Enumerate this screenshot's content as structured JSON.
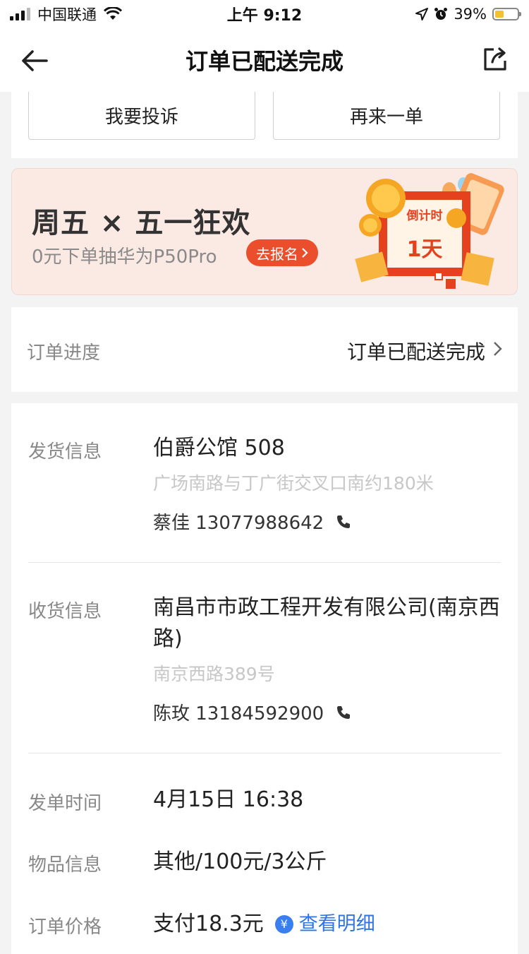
{
  "status_bar": {
    "carrier": "中国联通",
    "time": "上午 9:12",
    "battery_pct": "39%",
    "battery_level": 0.39,
    "icons": [
      "signal-icon",
      "wifi-icon",
      "location-arrow-icon",
      "alarm-icon",
      "battery-icon"
    ]
  },
  "nav": {
    "title": "订单已配送完成",
    "back_icon": "arrow-left-icon",
    "share_icon": "share-icon"
  },
  "actions": {
    "complain": "我要投诉",
    "reorder": "再来一单"
  },
  "banner": {
    "title": "周五 × 五一狂欢",
    "subtitle": "0元下单抽华为P50Pro",
    "cta": "去报名",
    "badge_line1": "倒计时",
    "badge_line2": "1天"
  },
  "progress": {
    "label": "订单进度",
    "status": "订单已配送完成"
  },
  "shipping": {
    "label": "发货信息",
    "name": "伯爵公馆 508",
    "address": "广场南路与丁广街交叉口南约180米",
    "contact": "蔡佳 13077988642"
  },
  "receiving": {
    "label": "收货信息",
    "name": "南昌市市政工程开发有限公司(南京西路)",
    "address": "南京西路389号",
    "contact": "陈玫 13184592900"
  },
  "order_time": {
    "label": "发单时间",
    "value": "4月15日 16:38"
  },
  "item_info": {
    "label": "物品信息",
    "value": "其他/100元/3公斤"
  },
  "price": {
    "label": "订单价格",
    "value": "支付18.3元",
    "detail_link": "查看明细",
    "yen_glyph": "¥"
  },
  "colors": {
    "accent_blue": "#2f73e6",
    "cta_red": "#ea4e2c",
    "banner_bg": "#fbeae4"
  }
}
